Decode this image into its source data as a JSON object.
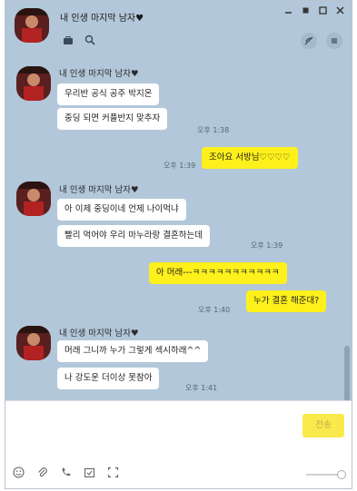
{
  "header": {
    "title": "내 인생 마지막 남자♥",
    "icons": [
      "bag-icon",
      "search-icon"
    ],
    "window_controls": [
      "minimize-icon",
      "pin-icon",
      "maximize-icon",
      "close-icon"
    ],
    "right_icons": [
      "mute-icon",
      "menu-icon"
    ]
  },
  "messages": {
    "group1": {
      "sender": "내 인생 마지막 남자♥",
      "m1": "우리반 공식 공주 박지온",
      "m2": "중딩 되면 커플반지 맞추자",
      "time": "오후 1:38"
    },
    "mine1": {
      "text": "조아요 서방님♡♡♡♡",
      "time": "오후 1:39"
    },
    "group2": {
      "sender": "내 인생 마지막 남자♥",
      "m1": "아 이제 중딩이네 언제 나이먹냐",
      "m2": "빨리 먹어야 우리 마누라랑 결혼하는데",
      "time": "오후 1:39"
    },
    "mine2": {
      "m1": "아 머래---ㅋㅋㅋㅋㅋㅋㅋㅋㅋㅋㅋ",
      "m2": "누가 결혼 해준대?",
      "time": "오후 1:40"
    },
    "group3": {
      "sender": "내 인생 마지막 남자♥",
      "m1": "머래 그니까 누가 그렇게 섹시하래^^",
      "m2": "나 강도운 더이상 못참아",
      "time": "오후 1:41"
    }
  },
  "input": {
    "send_label": "전송",
    "tools": [
      "emoji-icon",
      "attach-icon",
      "call-icon",
      "schedule-icon",
      "capture-icon"
    ]
  },
  "colors": {
    "bg": "#b2c7d9",
    "my_bubble": "#fef01b",
    "their_bubble": "#ffffff",
    "send": "#fae94a"
  }
}
